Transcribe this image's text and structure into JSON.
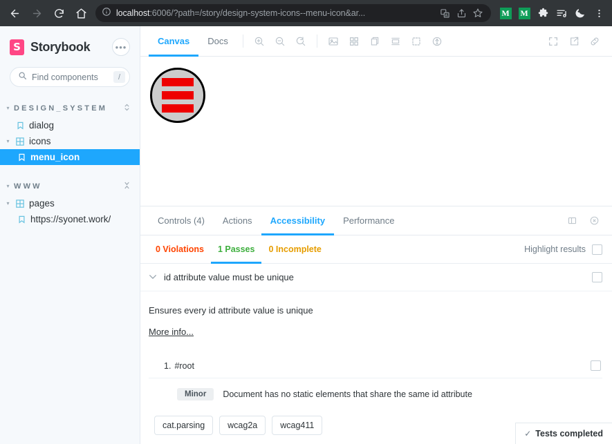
{
  "browser": {
    "back_icon": "back-arrow-icon",
    "forward_icon": "forward-arrow-icon",
    "reload_icon": "reload-icon",
    "home_icon": "home-icon",
    "info_icon": "site-info-icon",
    "url_host": "localhost",
    "url_rest": ":6006/?path=/story/design-system-icons--menu-icon&ar...",
    "url_full": "localhost:6006/?path=/story/design-system-icons--menu-icon&ar...",
    "pill_icons": [
      "translate-icon",
      "share-icon",
      "bookmark-star-icon"
    ],
    "extensions": [
      {
        "name": "extension-green-1",
        "glyph": "M"
      },
      {
        "name": "extension-green-2",
        "glyph": "M"
      }
    ],
    "puzzle_icon": "extensions-puzzle-icon",
    "list_icon": "reading-list-icon",
    "moon_icon": "dark-mode-icon",
    "menu_icon": "browser-menu-icon"
  },
  "sidebar": {
    "brand": "Storybook",
    "brand_initial": "S",
    "brand_color": "#ff4785",
    "more_label": "•••",
    "search": {
      "placeholder": "Find components",
      "shortcut": "/",
      "icon": "search-icon"
    },
    "sections": [
      {
        "label": "DESIGN_SYSTEM",
        "action_icon": "expand-collapse-icon",
        "items": [
          {
            "label": "dialog",
            "icon": "story-bookmark-icon",
            "depth": 1,
            "selected": false,
            "caret": ""
          },
          {
            "label": "icons",
            "icon": "component-grid-icon",
            "depth": 1,
            "selected": false,
            "caret": "▾"
          },
          {
            "label": "menu_icon",
            "icon": "story-bookmark-icon",
            "depth": 2,
            "selected": true,
            "caret": ""
          }
        ]
      },
      {
        "label": "WWW",
        "action_icon": "collapse-icon",
        "items": [
          {
            "label": "pages",
            "icon": "component-grid-icon",
            "depth": 1,
            "selected": false,
            "caret": "▾"
          },
          {
            "label": "https://syonet.work/",
            "icon": "story-bookmark-icon",
            "depth": 2,
            "selected": false,
            "caret": ""
          }
        ]
      }
    ]
  },
  "canvas_toolbar": {
    "tabs": [
      {
        "label": "Canvas",
        "active": true
      },
      {
        "label": "Docs",
        "active": false
      }
    ],
    "left_tools": [
      "zoom-in-icon",
      "zoom-out-icon",
      "zoom-reset-icon"
    ],
    "mid_tools": [
      "background-image-icon",
      "grid-icon",
      "measure-icon",
      "viewport-icon",
      "outline-icon",
      "accessibility-icon"
    ],
    "right_tools": [
      "fullscreen-icon",
      "open-new-tab-icon",
      "copy-link-icon"
    ]
  },
  "preview": {
    "story_name": "menu_icon",
    "art": {
      "circle_fill": "#cccccc",
      "circle_stroke": "#000000",
      "bar_color": "#ee0000",
      "bar_count": 3
    }
  },
  "panel": {
    "tabs": [
      {
        "label": "Controls (4)",
        "active": false
      },
      {
        "label": "Actions",
        "active": false
      },
      {
        "label": "Accessibility",
        "active": true
      },
      {
        "label": "Performance",
        "active": false
      }
    ],
    "right_tools": [
      "split-view-icon",
      "close-panel-icon"
    ],
    "a11y": {
      "tabs": [
        {
          "label": "0 Violations",
          "active": false,
          "kind": "violations"
        },
        {
          "label": "1 Passes",
          "active": true,
          "kind": "passes"
        },
        {
          "label": "0 Incomplete",
          "active": false,
          "kind": "incomplete"
        }
      ],
      "highlight_label": "Highlight results",
      "result": {
        "caret": "⌄",
        "title": "id attribute value must be unique",
        "description": "Ensures every id attribute value is unique",
        "more_info": "More info...",
        "nodes": [
          {
            "index": "1.",
            "selector": "#root",
            "impact": "Minor",
            "message": "Document has no static elements that share the same id attribute"
          }
        ],
        "tags": [
          "cat.parsing",
          "wcag2a",
          "wcag411"
        ]
      },
      "status": {
        "check": "✓",
        "label": "Tests completed"
      }
    }
  }
}
